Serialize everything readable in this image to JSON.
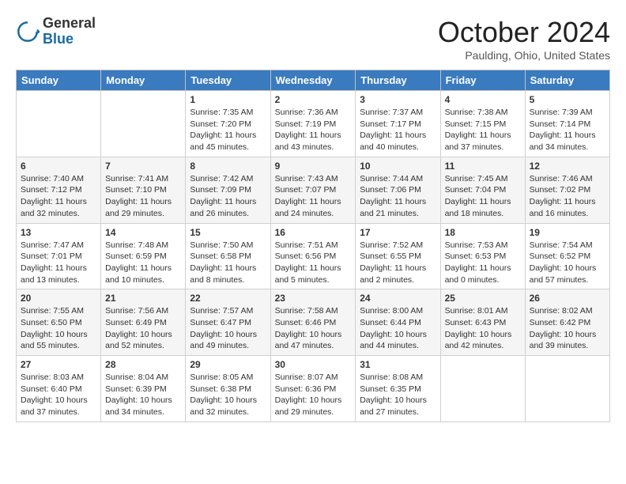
{
  "header": {
    "logo_general": "General",
    "logo_blue": "Blue",
    "month_title": "October 2024",
    "location": "Paulding, Ohio, United States"
  },
  "weekdays": [
    "Sunday",
    "Monday",
    "Tuesday",
    "Wednesday",
    "Thursday",
    "Friday",
    "Saturday"
  ],
  "weeks": [
    [
      {
        "day": "",
        "sunrise": "",
        "sunset": "",
        "daylight": ""
      },
      {
        "day": "",
        "sunrise": "",
        "sunset": "",
        "daylight": ""
      },
      {
        "day": "1",
        "sunrise": "Sunrise: 7:35 AM",
        "sunset": "Sunset: 7:20 PM",
        "daylight": "Daylight: 11 hours and 45 minutes."
      },
      {
        "day": "2",
        "sunrise": "Sunrise: 7:36 AM",
        "sunset": "Sunset: 7:19 PM",
        "daylight": "Daylight: 11 hours and 43 minutes."
      },
      {
        "day": "3",
        "sunrise": "Sunrise: 7:37 AM",
        "sunset": "Sunset: 7:17 PM",
        "daylight": "Daylight: 11 hours and 40 minutes."
      },
      {
        "day": "4",
        "sunrise": "Sunrise: 7:38 AM",
        "sunset": "Sunset: 7:15 PM",
        "daylight": "Daylight: 11 hours and 37 minutes."
      },
      {
        "day": "5",
        "sunrise": "Sunrise: 7:39 AM",
        "sunset": "Sunset: 7:14 PM",
        "daylight": "Daylight: 11 hours and 34 minutes."
      }
    ],
    [
      {
        "day": "6",
        "sunrise": "Sunrise: 7:40 AM",
        "sunset": "Sunset: 7:12 PM",
        "daylight": "Daylight: 11 hours and 32 minutes."
      },
      {
        "day": "7",
        "sunrise": "Sunrise: 7:41 AM",
        "sunset": "Sunset: 7:10 PM",
        "daylight": "Daylight: 11 hours and 29 minutes."
      },
      {
        "day": "8",
        "sunrise": "Sunrise: 7:42 AM",
        "sunset": "Sunset: 7:09 PM",
        "daylight": "Daylight: 11 hours and 26 minutes."
      },
      {
        "day": "9",
        "sunrise": "Sunrise: 7:43 AM",
        "sunset": "Sunset: 7:07 PM",
        "daylight": "Daylight: 11 hours and 24 minutes."
      },
      {
        "day": "10",
        "sunrise": "Sunrise: 7:44 AM",
        "sunset": "Sunset: 7:06 PM",
        "daylight": "Daylight: 11 hours and 21 minutes."
      },
      {
        "day": "11",
        "sunrise": "Sunrise: 7:45 AM",
        "sunset": "Sunset: 7:04 PM",
        "daylight": "Daylight: 11 hours and 18 minutes."
      },
      {
        "day": "12",
        "sunrise": "Sunrise: 7:46 AM",
        "sunset": "Sunset: 7:02 PM",
        "daylight": "Daylight: 11 hours and 16 minutes."
      }
    ],
    [
      {
        "day": "13",
        "sunrise": "Sunrise: 7:47 AM",
        "sunset": "Sunset: 7:01 PM",
        "daylight": "Daylight: 11 hours and 13 minutes."
      },
      {
        "day": "14",
        "sunrise": "Sunrise: 7:48 AM",
        "sunset": "Sunset: 6:59 PM",
        "daylight": "Daylight: 11 hours and 10 minutes."
      },
      {
        "day": "15",
        "sunrise": "Sunrise: 7:50 AM",
        "sunset": "Sunset: 6:58 PM",
        "daylight": "Daylight: 11 hours and 8 minutes."
      },
      {
        "day": "16",
        "sunrise": "Sunrise: 7:51 AM",
        "sunset": "Sunset: 6:56 PM",
        "daylight": "Daylight: 11 hours and 5 minutes."
      },
      {
        "day": "17",
        "sunrise": "Sunrise: 7:52 AM",
        "sunset": "Sunset: 6:55 PM",
        "daylight": "Daylight: 11 hours and 2 minutes."
      },
      {
        "day": "18",
        "sunrise": "Sunrise: 7:53 AM",
        "sunset": "Sunset: 6:53 PM",
        "daylight": "Daylight: 11 hours and 0 minutes."
      },
      {
        "day": "19",
        "sunrise": "Sunrise: 7:54 AM",
        "sunset": "Sunset: 6:52 PM",
        "daylight": "Daylight: 10 hours and 57 minutes."
      }
    ],
    [
      {
        "day": "20",
        "sunrise": "Sunrise: 7:55 AM",
        "sunset": "Sunset: 6:50 PM",
        "daylight": "Daylight: 10 hours and 55 minutes."
      },
      {
        "day": "21",
        "sunrise": "Sunrise: 7:56 AM",
        "sunset": "Sunset: 6:49 PM",
        "daylight": "Daylight: 10 hours and 52 minutes."
      },
      {
        "day": "22",
        "sunrise": "Sunrise: 7:57 AM",
        "sunset": "Sunset: 6:47 PM",
        "daylight": "Daylight: 10 hours and 49 minutes."
      },
      {
        "day": "23",
        "sunrise": "Sunrise: 7:58 AM",
        "sunset": "Sunset: 6:46 PM",
        "daylight": "Daylight: 10 hours and 47 minutes."
      },
      {
        "day": "24",
        "sunrise": "Sunrise: 8:00 AM",
        "sunset": "Sunset: 6:44 PM",
        "daylight": "Daylight: 10 hours and 44 minutes."
      },
      {
        "day": "25",
        "sunrise": "Sunrise: 8:01 AM",
        "sunset": "Sunset: 6:43 PM",
        "daylight": "Daylight: 10 hours and 42 minutes."
      },
      {
        "day": "26",
        "sunrise": "Sunrise: 8:02 AM",
        "sunset": "Sunset: 6:42 PM",
        "daylight": "Daylight: 10 hours and 39 minutes."
      }
    ],
    [
      {
        "day": "27",
        "sunrise": "Sunrise: 8:03 AM",
        "sunset": "Sunset: 6:40 PM",
        "daylight": "Daylight: 10 hours and 37 minutes."
      },
      {
        "day": "28",
        "sunrise": "Sunrise: 8:04 AM",
        "sunset": "Sunset: 6:39 PM",
        "daylight": "Daylight: 10 hours and 34 minutes."
      },
      {
        "day": "29",
        "sunrise": "Sunrise: 8:05 AM",
        "sunset": "Sunset: 6:38 PM",
        "daylight": "Daylight: 10 hours and 32 minutes."
      },
      {
        "day": "30",
        "sunrise": "Sunrise: 8:07 AM",
        "sunset": "Sunset: 6:36 PM",
        "daylight": "Daylight: 10 hours and 29 minutes."
      },
      {
        "day": "31",
        "sunrise": "Sunrise: 8:08 AM",
        "sunset": "Sunset: 6:35 PM",
        "daylight": "Daylight: 10 hours and 27 minutes."
      },
      {
        "day": "",
        "sunrise": "",
        "sunset": "",
        "daylight": ""
      },
      {
        "day": "",
        "sunrise": "",
        "sunset": "",
        "daylight": ""
      }
    ]
  ]
}
